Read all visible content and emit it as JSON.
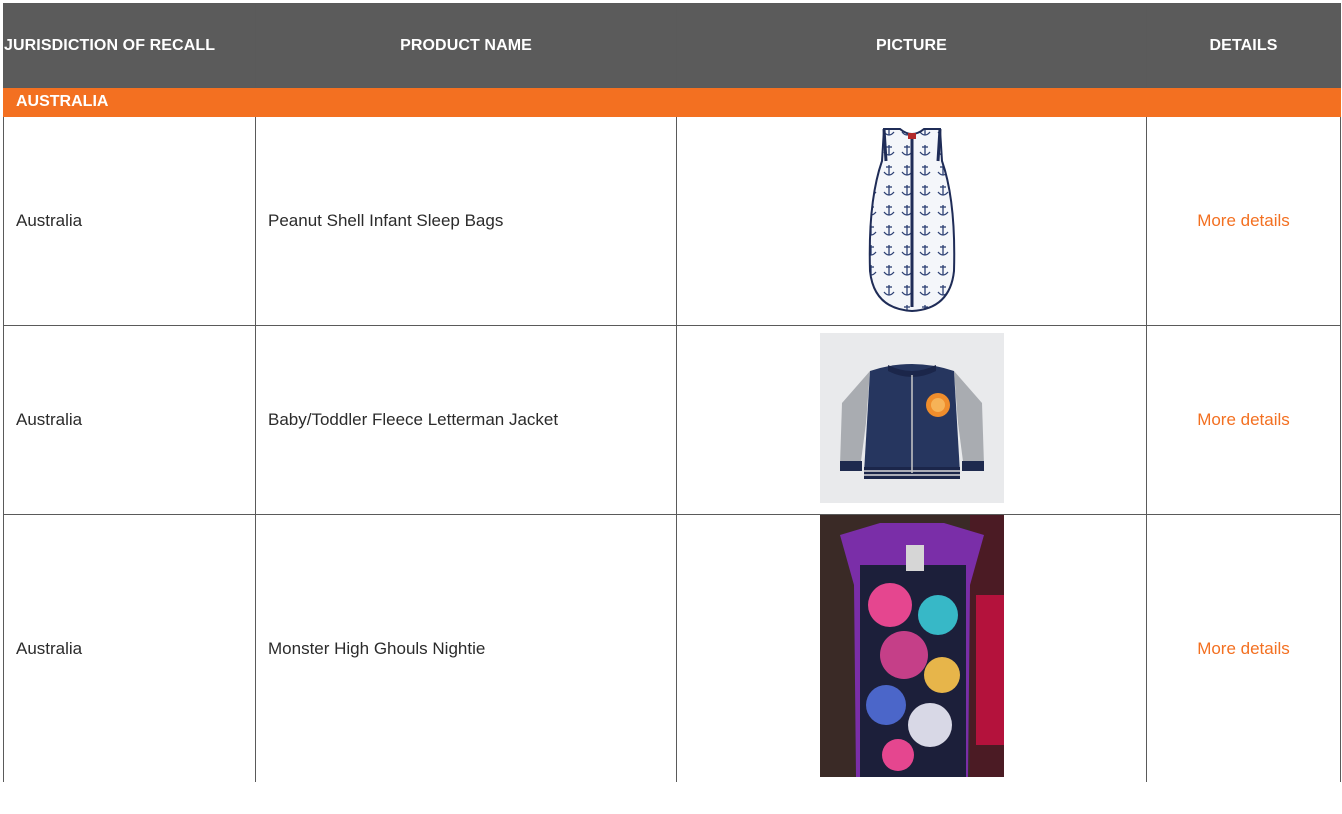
{
  "header": {
    "col1": "JURISDICTION OF RECALL",
    "col2": "PRODUCT NAME",
    "col3": "PICTURE",
    "col4": "DETAILS"
  },
  "section": {
    "label": "AUSTRALIA"
  },
  "rows": [
    {
      "jurisdiction": "Australia",
      "product": "Peanut Shell Infant Sleep Bags",
      "details": "More details",
      "picture": "sleep-bag-image"
    },
    {
      "jurisdiction": "Australia",
      "product": "Baby/Toddler Fleece Letterman Jacket",
      "details": "More details",
      "picture": "letterman-jacket-image"
    },
    {
      "jurisdiction": "Australia",
      "product": "Monster High Ghouls Nightie",
      "details": "More details",
      "picture": "nightie-image"
    }
  ],
  "colors": {
    "header_bg": "#5b5b5b",
    "accent": "#f37021",
    "border": "#5a5a5a"
  }
}
